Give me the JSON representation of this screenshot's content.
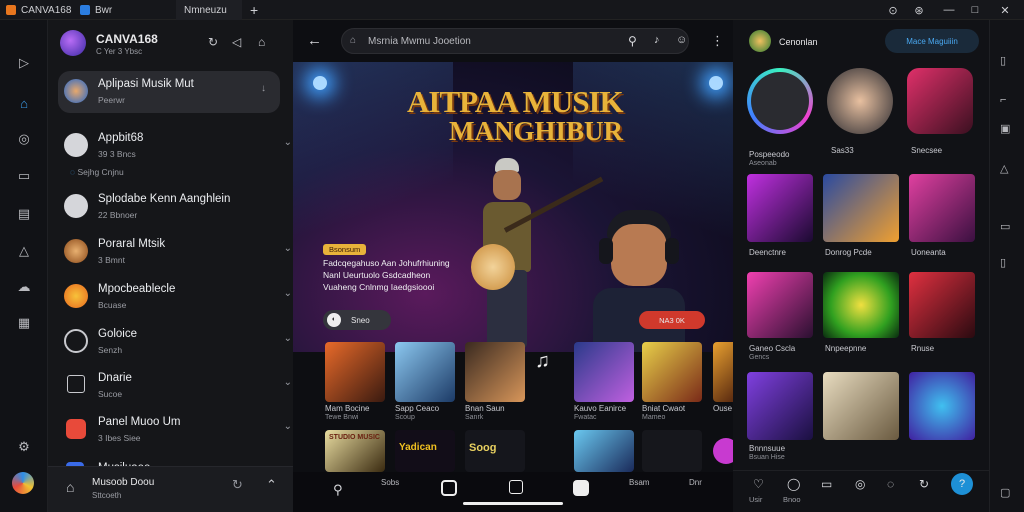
{
  "titlebar": {
    "app_name": "CANVA168",
    "tab1": "Bwr",
    "tab2": "Nmneuzu",
    "new_tab": "+",
    "win_buttons": [
      "⊙",
      "⊛",
      "—",
      "□",
      "✕"
    ]
  },
  "list_header": {
    "title": "CANVA168",
    "subtitle": "C Yer 3 Ybsc"
  },
  "conversations": [
    {
      "title": "Aplipasi Musik Mut",
      "sub": "Peerwr"
    },
    {
      "title": "Appbit68",
      "sub": "39 3 Bncs",
      "extra": "Sejhg Cnjnu"
    },
    {
      "title": "Splodabe Kenn Aanghlein",
      "sub": "22 Bbnoer"
    },
    {
      "title": "Poraral Mtsik",
      "sub": "3 Bmnt"
    },
    {
      "title": "Mpocbeablecle",
      "sub": "Bcuase"
    },
    {
      "title": "Goloice",
      "sub": "Senzh"
    },
    {
      "title": "Dnarie",
      "sub": "Sucoe"
    },
    {
      "title": "Panel Muoo Um",
      "sub": "3 Ibes Siee"
    },
    {
      "title": "Musiluaee",
      "sub": ""
    }
  ],
  "list_footer": {
    "label": "Musoob Doou",
    "sub": "Sttcoeth"
  },
  "center": {
    "search_placeholder": "Msrnia Mwmu Jooetion",
    "banner_title_line1": "AITPAA MUSIK",
    "banner_title_line2": "MANGHIBUR",
    "badge": "Bsonsum",
    "desc_line1": "Fadcqegahuso Aan Johufrhiuning",
    "desc_line2": "Nanl Ueurtuolo Gsdcadheon",
    "desc_line3": "Vuaheng Cnlnmg Iaedgsioooi",
    "play_label": "Sneo",
    "cta_label": "NA3 0K",
    "thumbs_row1": [
      {
        "t": "Mam Bocine",
        "s": "Tewe Bnwi"
      },
      {
        "t": "Sapp Ceaco",
        "s": "Scoup"
      },
      {
        "t": "Bnan Saun",
        "s": "Sanrk"
      },
      {
        "t": "Kauvo Eanirce",
        "s": "Fwatac"
      },
      {
        "t": "Bniat Cwaot",
        "s": "Mameo"
      },
      {
        "t": "Ouse",
        "s": ""
      }
    ],
    "thumbs_row2": [
      {
        "t": "STUDIO MUSIC"
      },
      {
        "t": "Yadican"
      },
      {
        "t": "Soog"
      },
      {
        "t": ""
      },
      {
        "t": ""
      }
    ],
    "bottom_nav": [
      "Sobs",
      "Bsam",
      "Dnr"
    ]
  },
  "right_panel": {
    "header_name": "Cenonlan",
    "header_btn": "Mace Maguiiin",
    "avatars": [
      {
        "t": "Pospeeodo",
        "s": "Aseonab"
      },
      {
        "t": "Sas33",
        "s": ""
      },
      {
        "t": "Snecsee",
        "s": ""
      }
    ],
    "grid": [
      {
        "t": "Deenctnre",
        "s": ""
      },
      {
        "t": "Donrog Pcde",
        "s": ""
      },
      {
        "t": "Uoneanta",
        "s": ""
      },
      {
        "t": "Ganeo Cscla",
        "s": "Gencs"
      },
      {
        "t": "Nnpeepnne",
        "s": ""
      },
      {
        "t": "Rnuse",
        "s": ""
      },
      {
        "t": "Bnnnsuue",
        "s": "Bsuan Hise"
      },
      {
        "t": "",
        "s": ""
      },
      {
        "t": "",
        "s": ""
      }
    ],
    "bottom_labels": [
      "Usir",
      "Bnoo"
    ]
  },
  "colors": {
    "accent": "#1e90d6",
    "bg": "#0b0c10",
    "banner_title": "#e8b33a"
  }
}
